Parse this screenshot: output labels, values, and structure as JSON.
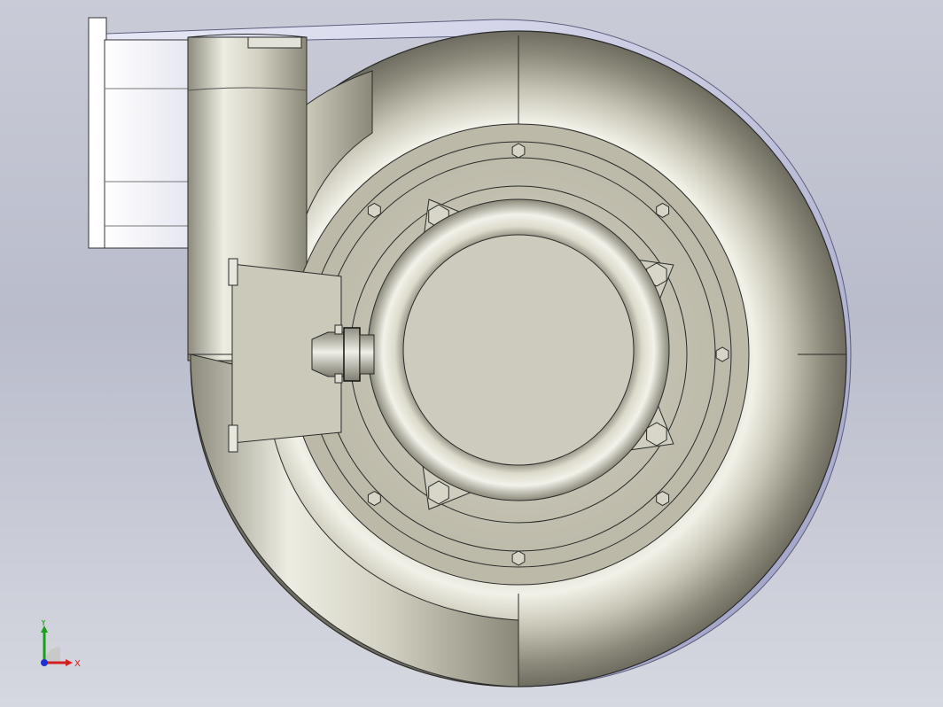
{
  "viewport": {
    "background_top": "#c9cbd7",
    "background_bottom": "#d6d8e0",
    "part_color": "#c8c5b4",
    "edge_color": "#2a2a2a"
  },
  "triad": {
    "x_label": "X",
    "y_label": "Y",
    "x_color": "#d22020",
    "y_color": "#18a018",
    "z_color": "#2030d0"
  }
}
